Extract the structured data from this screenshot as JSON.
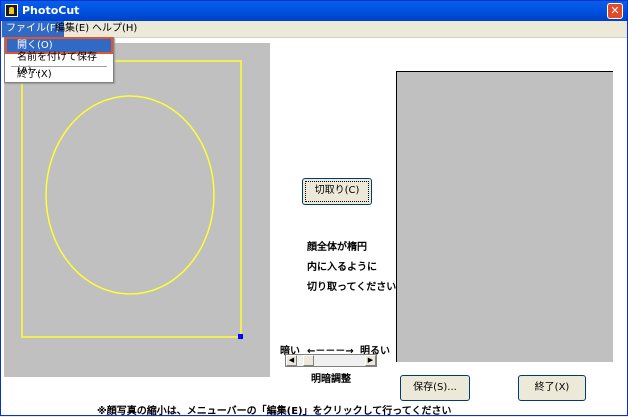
{
  "window": {
    "title": "PhotoCut",
    "close_label": "✕"
  },
  "menubar": {
    "file": "ファイル(F)",
    "edit": "編集(E)",
    "help": "ヘルプ(H)"
  },
  "file_menu": {
    "open": "開く(O)",
    "save_as": "名前を付けて保存(A)...",
    "exit": "終了(X)"
  },
  "cut_button": "切取り(C)",
  "instructions": [
    "顔全体が楕円",
    "内に入るように",
    "切り取ってください"
  ],
  "brightness": {
    "dark": "暗い",
    "arrow": "←－－－→",
    "bright": "明るい",
    "label": "明暗調整",
    "value": 0.1
  },
  "buttons": {
    "save": "保存(S)...",
    "exit": "終了(X)"
  },
  "footer": "※顔写真の縮小は、メニューバーの「編集(E)」をクリックして行ってください",
  "colors": {
    "accent": "#316ac5",
    "crop_guide": "#ffff33",
    "panel": "#c0c0c0",
    "handle": "#0000ff"
  }
}
